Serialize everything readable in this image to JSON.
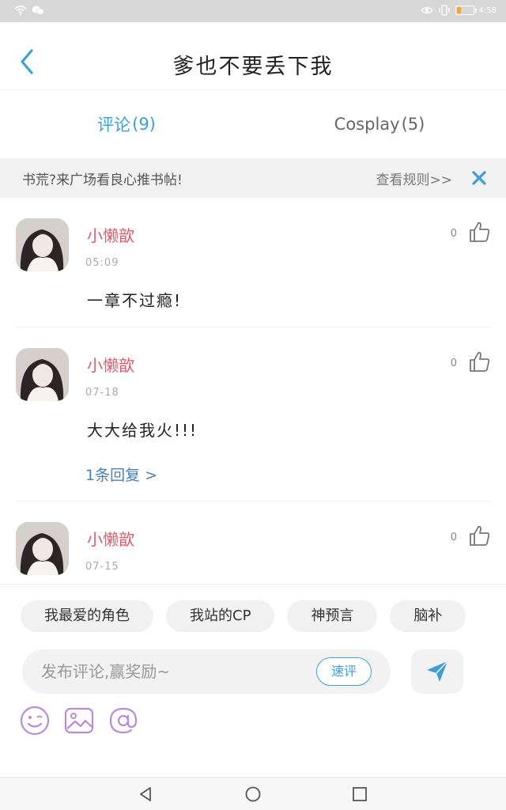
{
  "status_bar": {
    "time": "4:58"
  },
  "header": {
    "title": "爹也不要丢下我",
    "back_icon": "chevron-left-icon"
  },
  "tabs": [
    {
      "label": "评论",
      "count": "(9)",
      "active": true
    },
    {
      "label": "Cosplay",
      "count": "(5)",
      "active": false
    }
  ],
  "notice": {
    "text": "书荒?来广场看良心推书帖!",
    "link": "查看规则>>",
    "close_icon": "close-icon"
  },
  "comments": [
    {
      "username": "小懒歆",
      "time": "05:09",
      "text": "一章不过瘾!",
      "likes": "0",
      "replies": ""
    },
    {
      "username": "小懒歆",
      "time": "07-18",
      "text": "大大给我火!!!",
      "likes": "0",
      "replies": "1条回复 >"
    },
    {
      "username": "小懒歆",
      "time": "07-15",
      "text": "",
      "likes": "0",
      "replies": ""
    }
  ],
  "quick_tags": [
    "我最爱的角色",
    "我站的CP",
    "神预言",
    "脑补"
  ],
  "composer": {
    "placeholder": "发布评论,赢奖励~",
    "quick_label": "速评",
    "send_icon": "send-icon"
  },
  "tools": [
    "emoji-icon",
    "image-icon",
    "at-icon"
  ],
  "colors": {
    "accent": "#3b9fd8",
    "username": "#e2596c",
    "tool": "#b98be0"
  }
}
